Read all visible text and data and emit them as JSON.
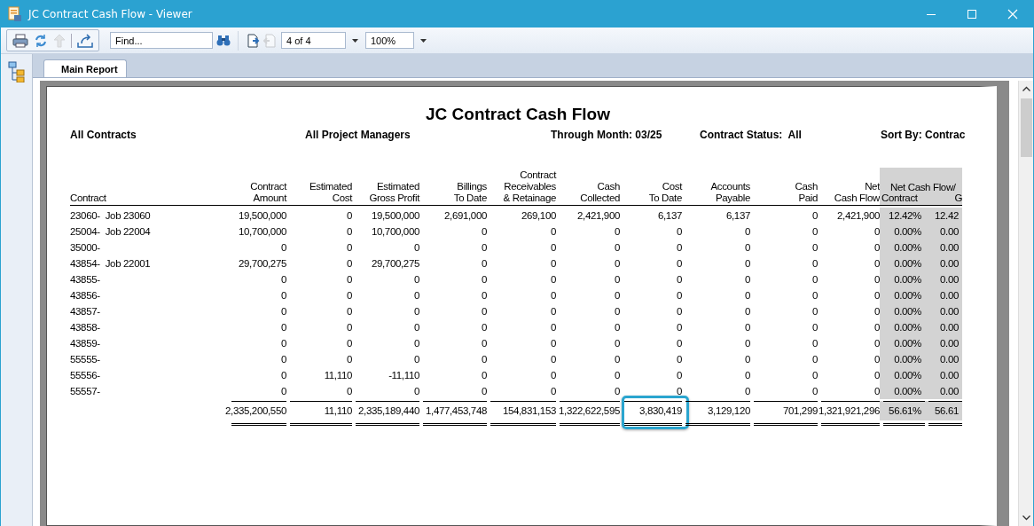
{
  "window": {
    "title": "JC Contract Cash Flow - Viewer"
  },
  "toolbar": {
    "buttons": [
      {
        "kind": "print",
        "disabled": false
      },
      {
        "kind": "refresh",
        "disabled": false
      },
      {
        "kind": "up",
        "disabled": true
      },
      {
        "kind": "export",
        "disabled": false
      }
    ],
    "find": {
      "placeholder": "Find..."
    },
    "pager": [
      {
        "kind": "next",
        "disabled": false
      },
      {
        "kind": "previous",
        "disabled": true
      }
    ],
    "page": "4 of 4",
    "zoom": "100%"
  },
  "tabs": [
    {
      "label": "Main Report",
      "selected": true
    }
  ],
  "report": {
    "title": "JC Contract Cash Flow",
    "filters": [
      "All Contracts",
      "All Project Managers",
      "Through Month: 03/25",
      "Contract Status:  All",
      "Sort By: Contrac"
    ],
    "group_header": "Net Cash Flow/",
    "columns": [
      {
        "lines": [
          "Contract"
        ],
        "shaded": false
      },
      {
        "lines": [
          "Contract",
          "Amount"
        ],
        "shaded": false
      },
      {
        "lines": [
          "Estimated",
          "Cost"
        ],
        "shaded": false
      },
      {
        "lines": [
          "Estimated",
          "Gross Profit"
        ],
        "shaded": false
      },
      {
        "lines": [
          "Billings",
          "To Date"
        ],
        "shaded": false
      },
      {
        "lines": [
          "Contract",
          "Receivables",
          "& Retainage"
        ],
        "shaded": false
      },
      {
        "lines": [
          "Cash",
          "Collected"
        ],
        "shaded": false
      },
      {
        "lines": [
          "Cost",
          "To Date"
        ],
        "shaded": false
      },
      {
        "lines": [
          "Accounts",
          "Payable"
        ],
        "shaded": false
      },
      {
        "lines": [
          "Cash",
          "Paid"
        ],
        "shaded": false
      },
      {
        "lines": [
          "Net",
          "Cash Flow"
        ],
        "shaded": false
      },
      {
        "lines": [
          "Contract"
        ],
        "shaded": true
      },
      {
        "lines": [
          "G"
        ],
        "shaded": true
      }
    ],
    "rows": [
      {
        "contract": "23060-",
        "job": "Job 23060",
        "values": [
          "19,500,000",
          "0",
          "19,500,000",
          "2,691,000",
          "269,100",
          "2,421,900",
          "6,137",
          "6,137",
          "0",
          "2,421,900",
          "12.42%",
          "12.42"
        ]
      },
      {
        "contract": "25004-",
        "job": "Job 22004",
        "values": [
          "10,700,000",
          "0",
          "10,700,000",
          "0",
          "0",
          "0",
          "0",
          "0",
          "0",
          "0",
          "0.00%",
          "0.00"
        ]
      },
      {
        "contract": "35000-",
        "values": [
          "0",
          "0",
          "0",
          "0",
          "0",
          "0",
          "0",
          "0",
          "0",
          "0",
          "0.00%",
          "0.00"
        ]
      },
      {
        "contract": "43854-",
        "job": "Job 22001",
        "values": [
          "29,700,275",
          "0",
          "29,700,275",
          "0",
          "0",
          "0",
          "0",
          "0",
          "0",
          "0",
          "0.00%",
          "0.00"
        ]
      },
      {
        "contract": "43855-",
        "values": [
          "0",
          "0",
          "0",
          "0",
          "0",
          "0",
          "0",
          "0",
          "0",
          "0",
          "0.00%",
          "0.00"
        ]
      },
      {
        "contract": "43856-",
        "values": [
          "0",
          "0",
          "0",
          "0",
          "0",
          "0",
          "0",
          "0",
          "0",
          "0",
          "0.00%",
          "0.00"
        ]
      },
      {
        "contract": "43857-",
        "values": [
          "0",
          "0",
          "0",
          "0",
          "0",
          "0",
          "0",
          "0",
          "0",
          "0",
          "0.00%",
          "0.00"
        ]
      },
      {
        "contract": "43858-",
        "values": [
          "0",
          "0",
          "0",
          "0",
          "0",
          "0",
          "0",
          "0",
          "0",
          "0",
          "0.00%",
          "0.00"
        ]
      },
      {
        "contract": "43859-",
        "values": [
          "0",
          "0",
          "0",
          "0",
          "0",
          "0",
          "0",
          "0",
          "0",
          "0",
          "0.00%",
          "0.00"
        ]
      },
      {
        "contract": "55555-",
        "values": [
          "0",
          "0",
          "0",
          "0",
          "0",
          "0",
          "0",
          "0",
          "0",
          "0",
          "0.00%",
          "0.00"
        ]
      },
      {
        "contract": "55556-",
        "values": [
          "0",
          "11,110",
          "-11,110",
          "0",
          "0",
          "0",
          "0",
          "0",
          "0",
          "0",
          "0.00%",
          "0.00"
        ]
      },
      {
        "contract": "55557-",
        "values": [
          "0",
          "0",
          "0",
          "0",
          "0",
          "0",
          "0",
          "0",
          "0",
          "0",
          "0.00%",
          "0.00"
        ]
      }
    ],
    "totals": [
      {
        "text": "2,335,200,550",
        "highlighted": false
      },
      {
        "text": "11,110",
        "highlighted": false
      },
      {
        "text": "2,335,189,440",
        "highlighted": false
      },
      {
        "text": "1,477,453,748",
        "highlighted": false
      },
      {
        "text": "154,831,153",
        "highlighted": false
      },
      {
        "text": "1,322,622,595",
        "highlighted": false
      },
      {
        "text": "3,830,419",
        "highlighted": true
      },
      {
        "text": "3,129,120",
        "highlighted": false
      },
      {
        "text": "701,299",
        "highlighted": false
      },
      {
        "text": "1,321,921,296",
        "highlighted": false
      },
      {
        "text": "56.61%",
        "highlighted": false
      },
      {
        "text": "56.61",
        "highlighted": false
      }
    ]
  }
}
